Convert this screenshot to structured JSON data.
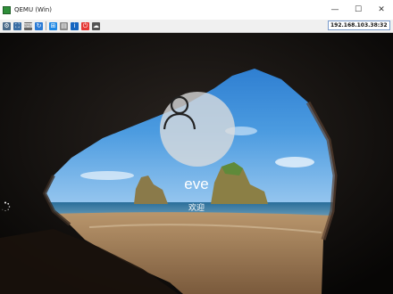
{
  "window": {
    "title": "QEMU (Win)",
    "controls": {
      "minimize": "—",
      "maximize": "☐",
      "close": "✕"
    }
  },
  "toolbar": {
    "buttons": [
      {
        "name": "settings-icon",
        "glyph": "⚙",
        "color": "#4a6b8a"
      },
      {
        "name": "fullscreen-icon",
        "glyph": "⛶",
        "color": "#3a6ea5"
      },
      {
        "name": "keyboard-icon",
        "glyph": "⌨",
        "color": "#666666"
      },
      {
        "name": "refresh-icon",
        "glyph": "↻",
        "color": "#2b7bd6"
      },
      {
        "name": "windows-key-icon",
        "glyph": "⊞",
        "color": "#1e88e5"
      },
      {
        "name": "document-icon",
        "glyph": "▤",
        "color": "#8a8a8a"
      },
      {
        "name": "info-icon",
        "glyph": "i",
        "color": "#1565c0"
      },
      {
        "name": "power-icon",
        "glyph": "⏻",
        "color": "#e53935"
      },
      {
        "name": "cloud-icon",
        "glyph": "☁",
        "color": "#555555"
      }
    ],
    "address": "192.168.103.38:32"
  },
  "login": {
    "username": "eve",
    "status": "欢迎"
  }
}
